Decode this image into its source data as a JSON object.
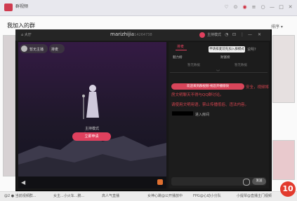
{
  "app": {
    "title": "群视频"
  },
  "window_controls": [
    "♡",
    "⊙",
    "◉",
    "≡",
    "○",
    "—",
    "□",
    "✕"
  ],
  "page": {
    "title": "我加入的群",
    "sort_label": "排序 ▾"
  },
  "room": {
    "header_left": "⌂ 大厅",
    "name": "marizhijia",
    "id_text": "814264738",
    "mode_label": "主持模式",
    "icons": [
      "◔",
      "⊡",
      "⋮",
      "—",
      "✕"
    ]
  },
  "stage": {
    "host_label": "暂无主播",
    "mic_label": "排麦",
    "mode_caption": "主持模式",
    "apply_button": "立即申请"
  },
  "panel": {
    "tab_active": "排麦",
    "queue_button": "申请排麦前先加入群模式",
    "help_label": "说明?",
    "sub_tabs": [
      "魅力榜",
      "财富榜"
    ],
    "empty_left": "暂无数据",
    "empty_right": "暂无数据",
    "notice_pill": "欢迎来到群视频·祝您开播愉快",
    "red_lines": [
      "安全，视频将",
      "房文明聊天不得与QQ群讨论。",
      "请使用文明用语，禁止传播低俗、违法内容。"
    ],
    "entered_text": "进入房间",
    "send_button": "发送"
  },
  "bottom_captions": [
    "@2 ● 当前视频群...",
    "女主...小火车...鹏...",
    "高人气直播",
    "女神心跳@公开播放中",
    "FPG@心动小分队",
    "小提琴@直播主门视频"
  ],
  "badge": "10",
  "colors": {
    "accent": "#e0405e",
    "brand": "#cf3b4f",
    "badge": "#e23b2e"
  }
}
